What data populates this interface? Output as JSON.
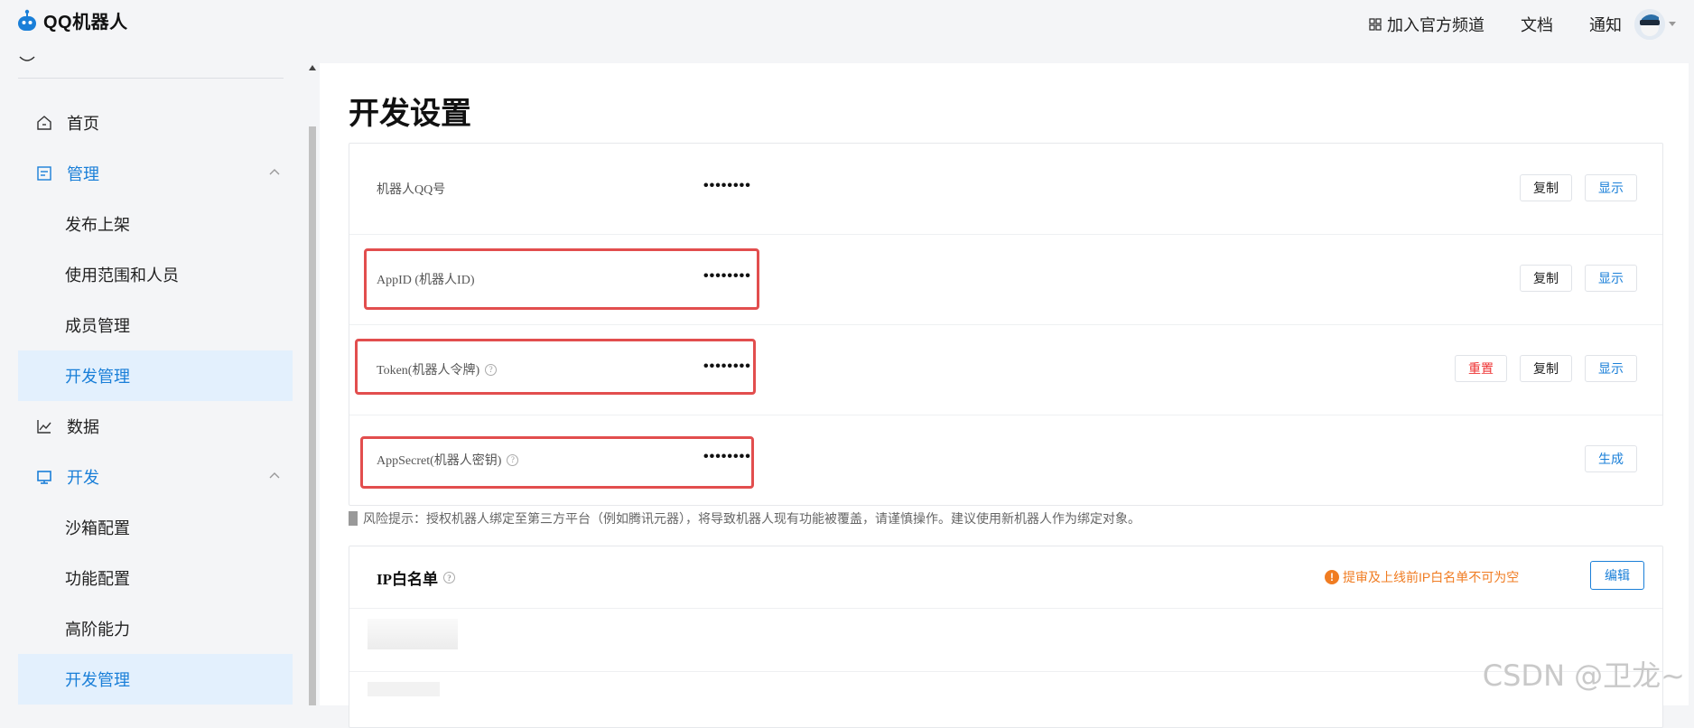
{
  "app": {
    "name": "QQ机器人"
  },
  "topnav": {
    "join": "加入官方频道",
    "docs": "文档",
    "notify": "通知"
  },
  "sidebar": {
    "items": [
      {
        "label": "首页"
      },
      {
        "label": "管理"
      },
      {
        "label": "发布上架"
      },
      {
        "label": "使用范围和人员"
      },
      {
        "label": "成员管理"
      },
      {
        "label": "开发管理"
      },
      {
        "label": "数据"
      },
      {
        "label": "开发"
      },
      {
        "label": "沙箱配置"
      },
      {
        "label": "功能配置"
      },
      {
        "label": "高阶能力"
      },
      {
        "label": "开发管理"
      }
    ]
  },
  "page": {
    "title": "开发设置"
  },
  "rows": [
    {
      "label": "机器人QQ号",
      "value": "••••••••"
    },
    {
      "label": "AppID (机器人ID)",
      "value": "••••••••"
    },
    {
      "label": "Token(机器人令牌)",
      "value": "••••••••"
    },
    {
      "label": "AppSecret(机器人密钥)",
      "value": "••••••••"
    }
  ],
  "buttons": {
    "copy": "复制",
    "show": "显示",
    "reset": "重置",
    "generate": "生成",
    "edit": "编辑"
  },
  "risk": {
    "text": "风险提示：授权机器人绑定至第三方平台（例如腾讯元器），将导致机器人现有功能被覆盖，请谨慎操作。建议使用新机器人作为绑定对象。"
  },
  "ip": {
    "title": "IP白名单",
    "warning": "提审及上线前IP白名单不可为空"
  },
  "watermark": "CSDN @卫龙~",
  "colors": {
    "accent": "#1a7fd8",
    "highlight": "#e24e4e",
    "warning": "#f07c22",
    "danger": "#e33333"
  }
}
